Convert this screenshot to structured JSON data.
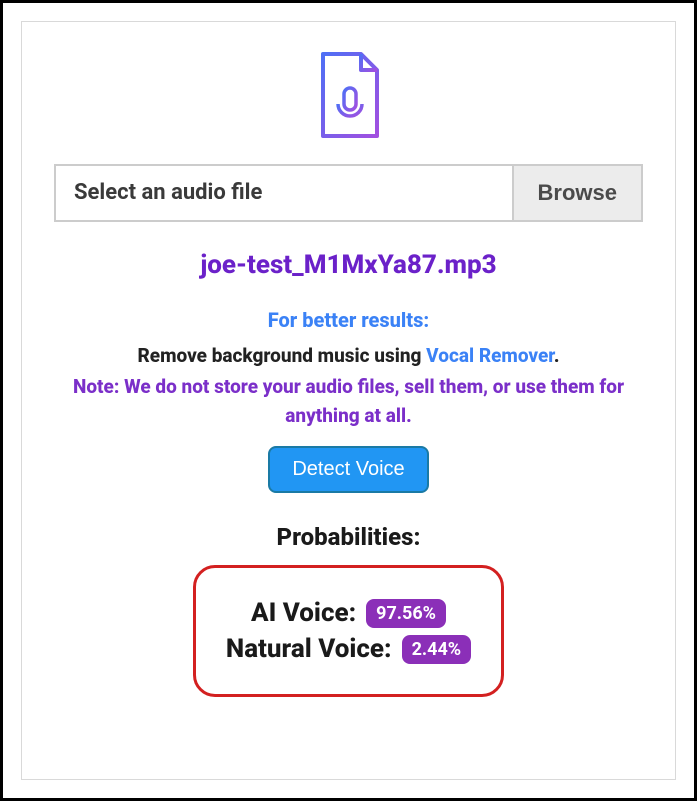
{
  "upload": {
    "placeholder": "Select an audio file",
    "browse_label": "Browse"
  },
  "filename": "joe-test_M1MxYa87.mp3",
  "hints": {
    "title": "For better results:",
    "line1_prefix": "Remove background music using ",
    "line1_link": "Vocal Remover",
    "line1_suffix": ".",
    "note_prefix": "Note: ",
    "note_body": "We do not store your audio files, sell them, or use them for anything at all."
  },
  "detect_label": "Detect Voice",
  "results": {
    "title": "Probabilities:",
    "ai_label": "AI Voice:",
    "ai_value": "97.56%",
    "natural_label": "Natural Voice:",
    "natural_value": "2.44%"
  }
}
